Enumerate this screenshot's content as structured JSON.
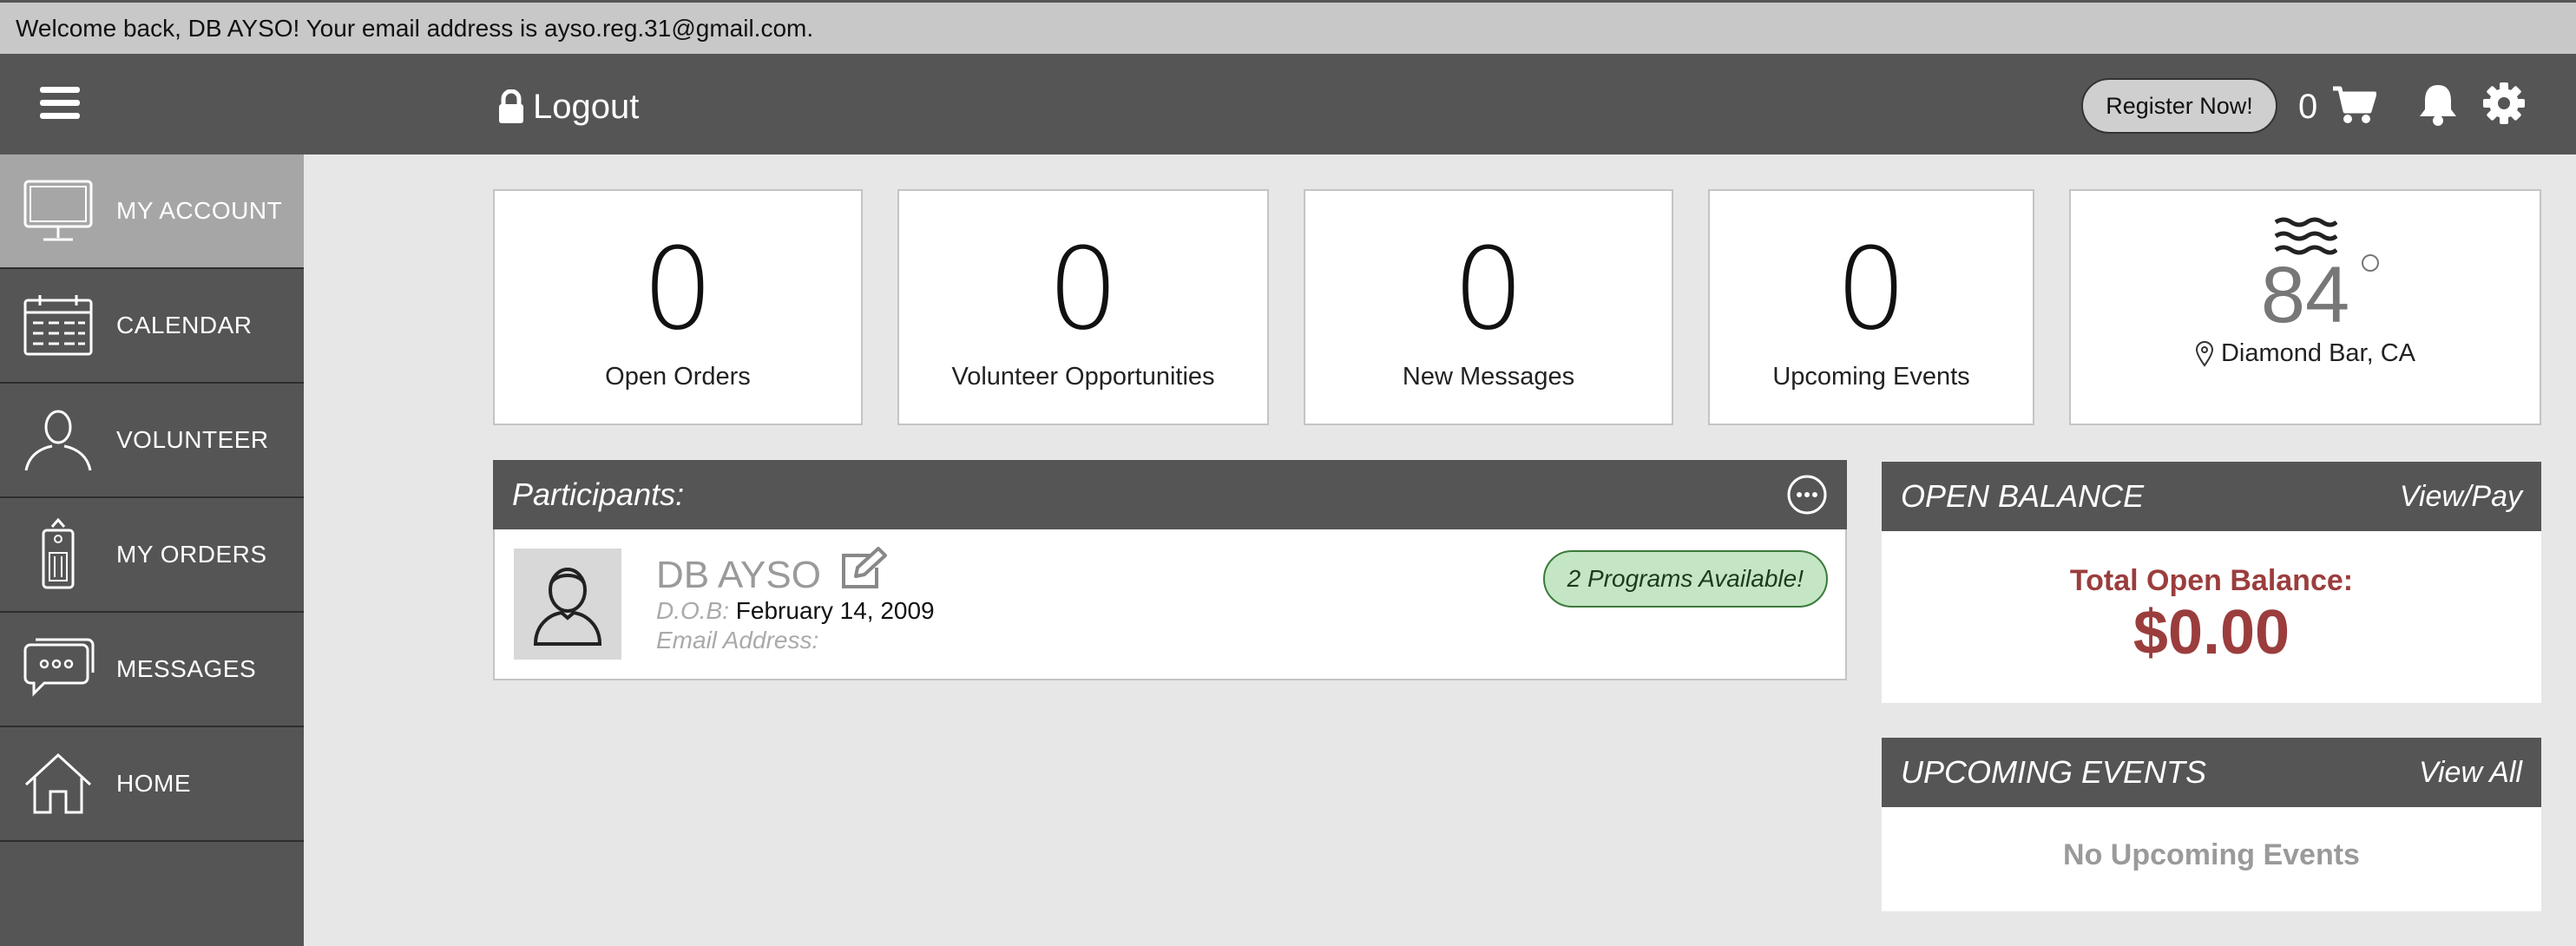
{
  "welcome": "Welcome back, DB AYSO! Your email address is ayso.reg.31@gmail.com.",
  "header": {
    "logout_label": "Logout",
    "register_label": "Register Now!",
    "cart_count": "0"
  },
  "sidebar": {
    "items": [
      {
        "label": "MY ACCOUNT",
        "icon": "monitor-icon"
      },
      {
        "label": "CALENDAR",
        "icon": "calendar-icon"
      },
      {
        "label": "VOLUNTEER",
        "icon": "person-icon"
      },
      {
        "label": "MY ORDERS",
        "icon": "tag-icon"
      },
      {
        "label": "MESSAGES",
        "icon": "chat-icon"
      },
      {
        "label": "HOME",
        "icon": "home-icon"
      }
    ]
  },
  "stats": [
    {
      "value": "0",
      "label": "Open Orders"
    },
    {
      "value": "0",
      "label": "Volunteer Opportunities"
    },
    {
      "value": "0",
      "label": "New Messages"
    },
    {
      "value": "0",
      "label": "Upcoming Events"
    }
  ],
  "weather": {
    "temperature": "84",
    "location": "Diamond Bar, CA",
    "icon": "fog-icon"
  },
  "participants": {
    "title": "Participants:",
    "items": [
      {
        "name": "DB AYSO",
        "dob_label": "D.O.B:",
        "dob": "February 14, 2009",
        "email_label": "Email Address:",
        "email": "",
        "programs_badge": "2 Programs Available!"
      }
    ]
  },
  "open_balance": {
    "title": "OPEN BALANCE",
    "link": "View/Pay",
    "label": "Total Open Balance:",
    "amount": "$0.00"
  },
  "upcoming_events": {
    "title": "UPCOMING EVENTS",
    "link": "View All",
    "empty_text": "No Upcoming Events"
  },
  "colors": {
    "header_bg": "#555555",
    "sidebar_active": "#a6a6a6",
    "balance_red": "#9b3d3d",
    "badge_green": "#c4e6c4"
  }
}
